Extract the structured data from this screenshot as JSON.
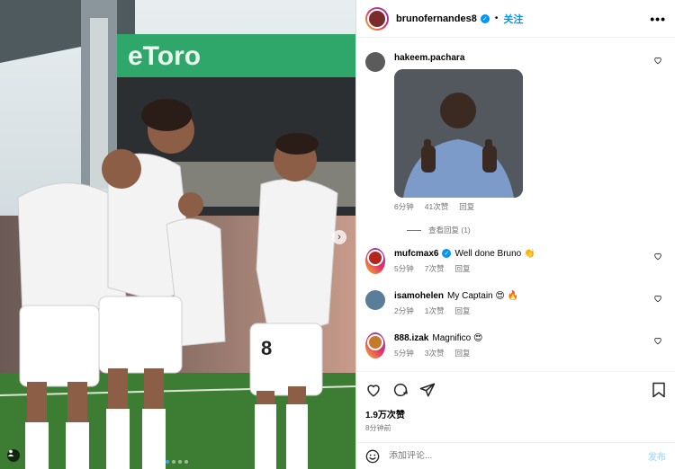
{
  "post": {
    "author": "brunofernandes8",
    "follow_label": "关注",
    "more_label": "•••",
    "carousel_dots": 4,
    "active_dot": 1,
    "banner_text": "eToro"
  },
  "comments": [
    {
      "user": "hakeem.pachara",
      "text": "",
      "time": "6分钟",
      "likes": "41次赞",
      "reply": "回复",
      "has_gif": true,
      "avatar_color": "#6b6b6b",
      "verified": false
    },
    {
      "user": "mufcmax6",
      "text": "Well done Bruno 👏",
      "time": "5分钟",
      "likes": "7次赞",
      "reply": "回复",
      "has_gif": false,
      "avatar_color": "#b3261e",
      "verified": true
    },
    {
      "user": "isamohelen",
      "text": "My Captain 😍 🔥",
      "time": "2分钟",
      "likes": "1次赞",
      "reply": "回复",
      "has_gif": false,
      "avatar_color": "#5a7d9a",
      "verified": false
    },
    {
      "user": "888.izak",
      "text": "Magnifico 😍",
      "time": "5分钟",
      "likes": "3次赞",
      "reply": "回复",
      "has_gif": false,
      "avatar_color": "#c47a2a",
      "verified": false
    }
  ],
  "view_replies": "查看回复 (1)",
  "likes_count": "1.9万次赞",
  "post_time": "8分钟前",
  "add_comment": {
    "placeholder": "添加评论...",
    "post_label": "发布",
    "emoji_icon": "smile-icon"
  },
  "colors": {
    "accent": "#0095f6",
    "muted": "#737373",
    "kit": "#f3f3f3",
    "pitch": "#3c7d33"
  }
}
